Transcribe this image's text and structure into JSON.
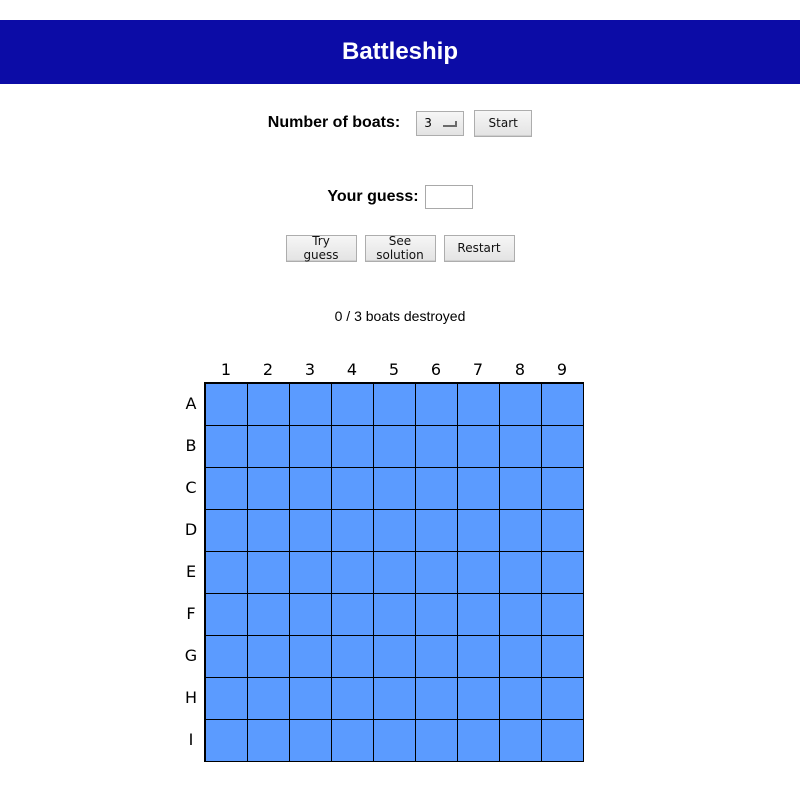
{
  "app": {
    "title": "Battleship"
  },
  "setup": {
    "boats_label": "Number of boats:",
    "boats_selected": "3",
    "start_label": "Start"
  },
  "guess": {
    "label": "Your guess:",
    "value": "",
    "placeholder": ""
  },
  "actions": {
    "try_label": "Try guess",
    "solution_label": "See solution",
    "restart_label": "Restart"
  },
  "status": {
    "text": "0 / 3 boats destroyed"
  },
  "board": {
    "columns": [
      "1",
      "2",
      "3",
      "4",
      "5",
      "6",
      "7",
      "8",
      "9"
    ],
    "rows": [
      "A",
      "B",
      "C",
      "D",
      "E",
      "F",
      "G",
      "H",
      "I"
    ],
    "water_color": "#5b9bff",
    "grid_color": "#000000"
  },
  "colors": {
    "header_bg": "#0c0ca6",
    "header_text": "#ffffff"
  }
}
